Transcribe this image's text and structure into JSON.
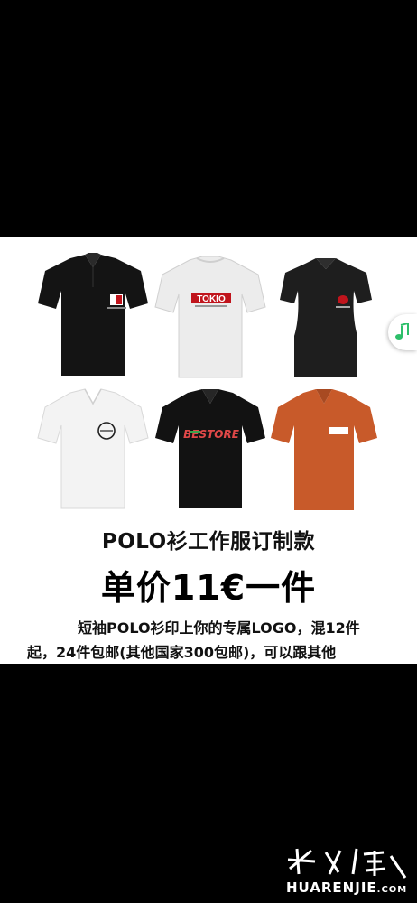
{
  "products": [
    {
      "name": "black polo front with logo",
      "color": "#141414"
    },
    {
      "name": "white polo back with TOKIO print",
      "color": "#ececec",
      "print_text": "TOKIO"
    },
    {
      "name": "women black polo with red logo",
      "color": "#1e1e1e"
    },
    {
      "name": "white polo with circular logo",
      "color": "#f3f3f3"
    },
    {
      "name": "black polo with BESTORE print",
      "color": "#121212",
      "print_text": "BESTORE"
    },
    {
      "name": "orange polo with white label",
      "color": "#c85a2a"
    }
  ],
  "headline": "POLO衫工作服订制款",
  "price": "单价11€一件",
  "description": "短袖POLO衫印上你的专属LOGO，混12件起，24件包邮(其他国家300包邮)，可以跟其他",
  "music_icon": "music-note-icon",
  "watermark": {
    "text": "HUARENJIE",
    "domain": ".COM"
  }
}
